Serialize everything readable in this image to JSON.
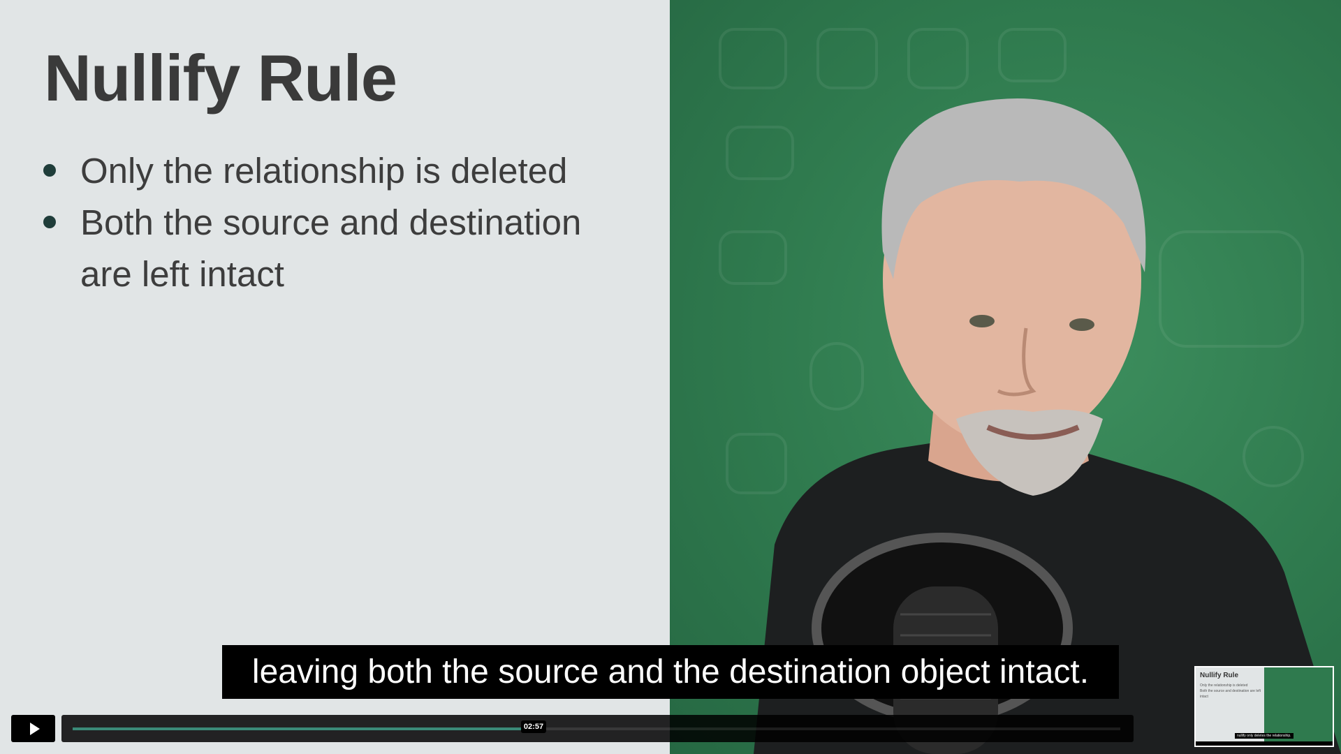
{
  "slide": {
    "title": "Nullify Rule",
    "bullets": [
      "Only the relationship is deleted",
      "Both the source and destination are left intact"
    ]
  },
  "caption": "leaving both the source and the destination object intact.",
  "player": {
    "progress_fraction": 0.44,
    "hover_time": "02:57",
    "play_icon": "play-icon"
  },
  "thumbnail": {
    "title": "Nullify Rule",
    "bullets": [
      "Only the relationship is deleted",
      "Both the source and destination are left intact"
    ],
    "caption": "nullify only deletes the relationship."
  },
  "colors": {
    "slide_bg": "#e1e5e6",
    "green_screen": "#2f7a4e",
    "progress": "#3b8a78"
  }
}
